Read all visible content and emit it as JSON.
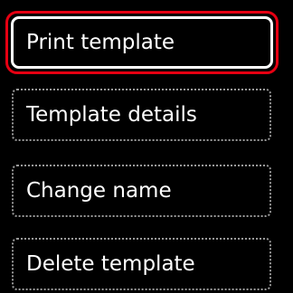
{
  "menu": {
    "items": [
      {
        "label": "Print template",
        "selected": true
      },
      {
        "label": "Template details",
        "selected": false
      },
      {
        "label": "Change name",
        "selected": false
      },
      {
        "label": "Delete template",
        "selected": false
      }
    ]
  },
  "colors": {
    "background": "#000000",
    "selection_outer": "#e60012",
    "selection_inner": "#ffffff",
    "item_border": "#9a9a9a",
    "text": "#ffffff"
  }
}
